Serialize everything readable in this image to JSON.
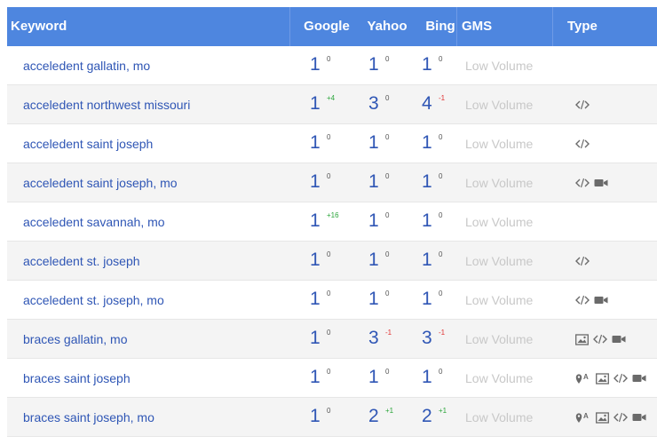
{
  "header": {
    "keyword": "Keyword",
    "google": "Google",
    "yahoo": "Yahoo",
    "bing": "Bing",
    "gms": "GMS",
    "type": "Type"
  },
  "gms_value": "Low Volume",
  "rows": [
    {
      "keyword": "acceledent gallatin, mo",
      "google": "1",
      "google_chg": "0",
      "yahoo": "1",
      "yahoo_chg": "0",
      "bing": "1",
      "bing_chg": "0",
      "gms": "Low Volume",
      "types": []
    },
    {
      "keyword": "acceledent northwest missouri",
      "google": "1",
      "google_chg": "+4",
      "yahoo": "3",
      "yahoo_chg": "0",
      "bing": "4",
      "bing_chg": "-1",
      "gms": "Low Volume",
      "types": [
        "code-icon"
      ]
    },
    {
      "keyword": "acceledent saint joseph",
      "google": "1",
      "google_chg": "0",
      "yahoo": "1",
      "yahoo_chg": "0",
      "bing": "1",
      "bing_chg": "0",
      "gms": "Low Volume",
      "types": [
        "code-icon"
      ]
    },
    {
      "keyword": "acceledent saint joseph, mo",
      "google": "1",
      "google_chg": "0",
      "yahoo": "1",
      "yahoo_chg": "0",
      "bing": "1",
      "bing_chg": "0",
      "gms": "Low Volume",
      "types": [
        "code-icon",
        "video-icon"
      ]
    },
    {
      "keyword": "acceledent savannah, mo",
      "google": "1",
      "google_chg": "+16",
      "yahoo": "1",
      "yahoo_chg": "0",
      "bing": "1",
      "bing_chg": "0",
      "gms": "Low Volume",
      "types": []
    },
    {
      "keyword": "acceledent st. joseph",
      "google": "1",
      "google_chg": "0",
      "yahoo": "1",
      "yahoo_chg": "0",
      "bing": "1",
      "bing_chg": "0",
      "gms": "Low Volume",
      "types": [
        "code-icon"
      ]
    },
    {
      "keyword": "acceledent st. joseph, mo",
      "google": "1",
      "google_chg": "0",
      "yahoo": "1",
      "yahoo_chg": "0",
      "bing": "1",
      "bing_chg": "0",
      "gms": "Low Volume",
      "types": [
        "code-icon",
        "video-icon"
      ]
    },
    {
      "keyword": "braces gallatin, mo",
      "google": "1",
      "google_chg": "0",
      "yahoo": "3",
      "yahoo_chg": "-1",
      "bing": "3",
      "bing_chg": "-1",
      "gms": "Low Volume",
      "types": [
        "image-icon",
        "code-icon",
        "video-icon"
      ]
    },
    {
      "keyword": "braces saint joseph",
      "google": "1",
      "google_chg": "0",
      "yahoo": "1",
      "yahoo_chg": "0",
      "bing": "1",
      "bing_chg": "0",
      "gms": "Low Volume",
      "types": [
        "map-pin-icon",
        "image-icon",
        "code-icon",
        "video-icon"
      ]
    },
    {
      "keyword": "braces saint joseph, mo",
      "google": "1",
      "google_chg": "0",
      "yahoo": "2",
      "yahoo_chg": "+1",
      "bing": "2",
      "bing_chg": "+1",
      "gms": "Low Volume",
      "types": [
        "map-pin-icon",
        "image-icon",
        "code-icon",
        "video-icon"
      ]
    }
  ],
  "colors": {
    "header_bg": "#4e86df",
    "keyword_link": "#2f56b5",
    "up": "#2aa53a",
    "down": "#e03030",
    "muted": "#c8c8c8"
  }
}
